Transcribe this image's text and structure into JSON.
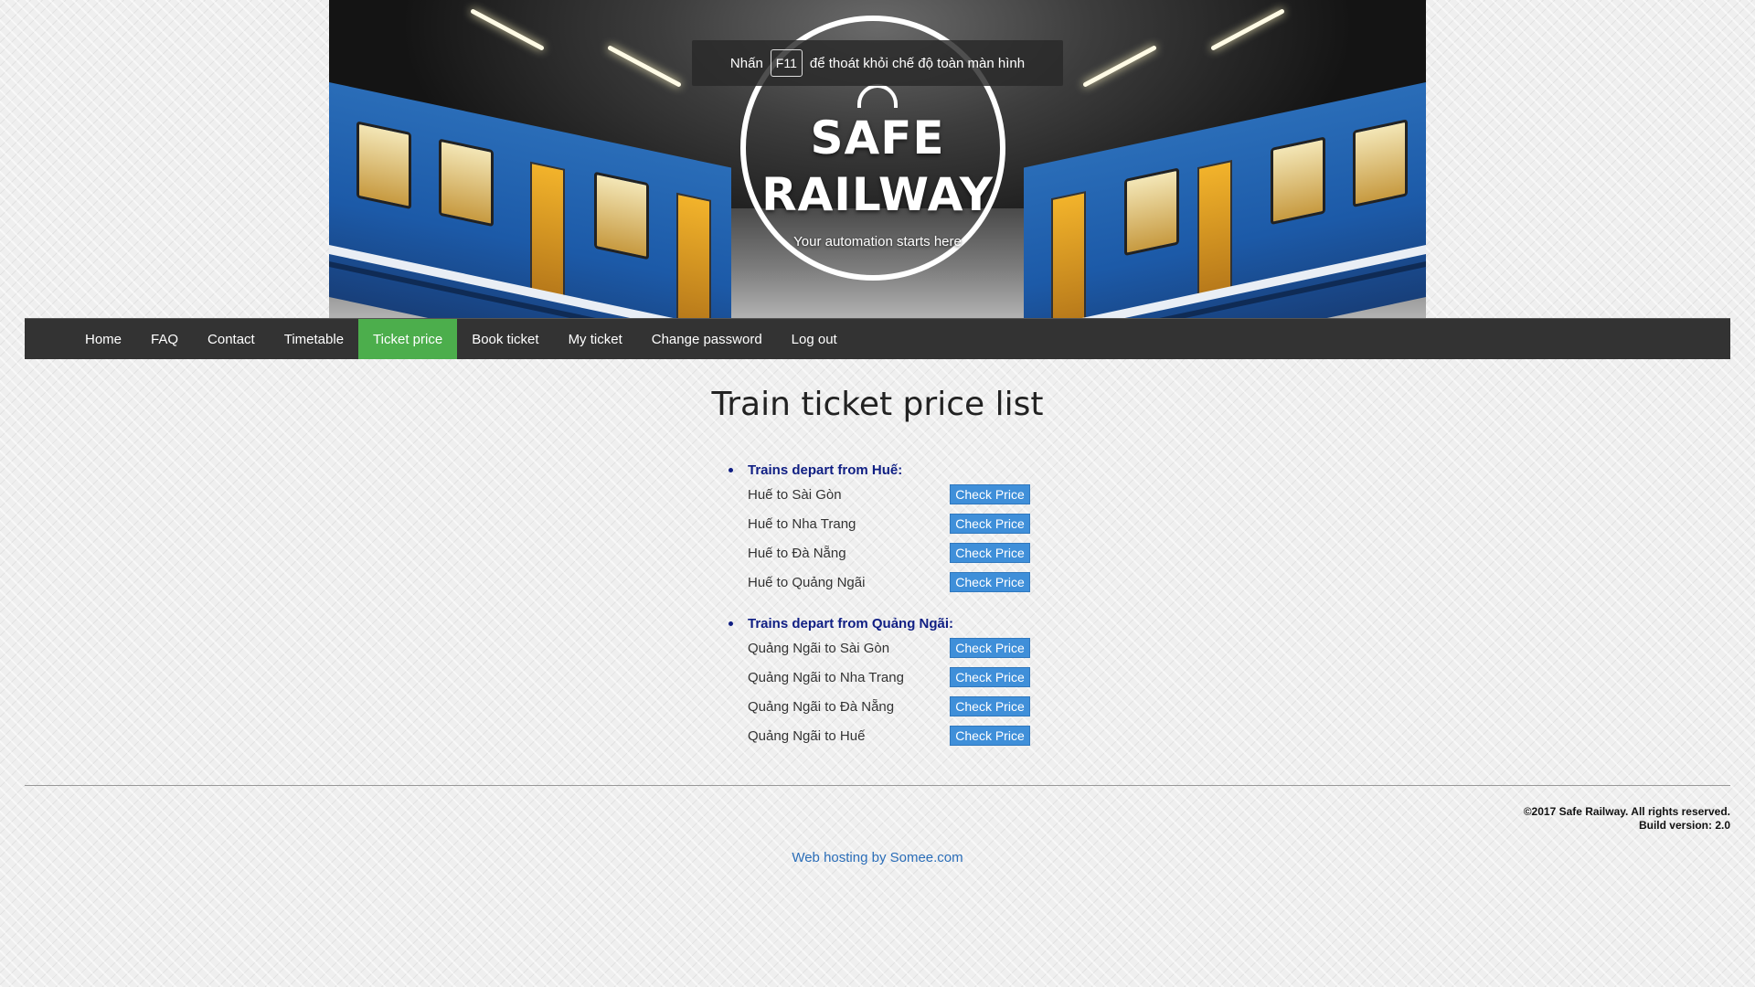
{
  "banner": {
    "title_line1": "SAFE",
    "title_line2": "RAILWAY",
    "tagline": "Your automation starts here",
    "fullscreen_notice": {
      "before": "Nhấn",
      "key": "F11",
      "after": "để thoát khỏi chế độ toàn màn hình"
    }
  },
  "nav": {
    "items": [
      {
        "label": "Home"
      },
      {
        "label": "FAQ"
      },
      {
        "label": "Contact"
      },
      {
        "label": "Timetable"
      },
      {
        "label": "Ticket price",
        "active": true
      },
      {
        "label": "Book ticket"
      },
      {
        "label": "My ticket"
      },
      {
        "label": "Change password"
      },
      {
        "label": "Log out"
      }
    ],
    "active_color": "#4cae4c",
    "bar_color": "#333333"
  },
  "main": {
    "title": "Train ticket price list",
    "groups": [
      {
        "heading": "Trains depart from Huế:",
        "routes": [
          {
            "label": "Huế to Sài Gòn",
            "button": "Check Price"
          },
          {
            "label": "Huế to Nha Trang",
            "button": "Check Price"
          },
          {
            "label": "Huế to Đà Nẵng",
            "button": "Check Price"
          },
          {
            "label": "Huế to Quảng Ngãi",
            "button": "Check Price"
          }
        ]
      },
      {
        "heading": "Trains depart from Quảng Ngãi:",
        "routes": [
          {
            "label": "Quảng Ngãi to Sài Gòn",
            "button": "Check Price"
          },
          {
            "label": "Quảng Ngãi to Nha Trang",
            "button": "Check Price"
          },
          {
            "label": "Quảng Ngãi to Đà Nẵng",
            "button": "Check Price"
          },
          {
            "label": "Quảng Ngãi to Huế",
            "button": "Check Price"
          }
        ]
      }
    ],
    "button_color": "#3f8fd9",
    "heading_color": "#0f1e83"
  },
  "footer": {
    "copyright": "©2017 Safe Railway. All rights reserved.",
    "build": "Build version: 2.0",
    "hosting_link": "Web hosting by Somee.com"
  }
}
